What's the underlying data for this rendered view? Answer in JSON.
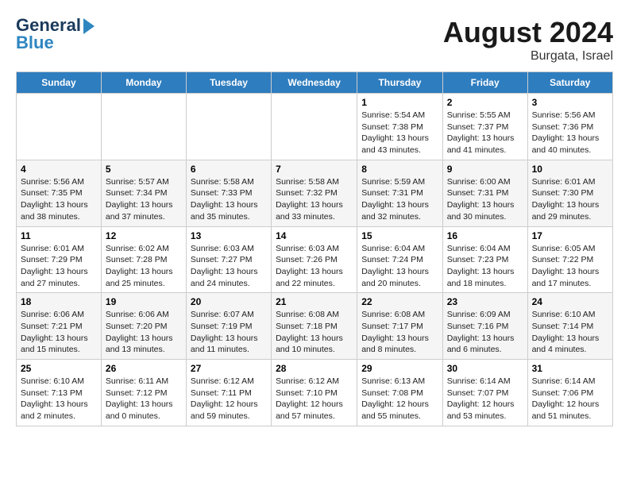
{
  "header": {
    "logo_line1": "General",
    "logo_line2": "Blue",
    "month_year": "August 2024",
    "location": "Burgata, Israel"
  },
  "weekdays": [
    "Sunday",
    "Monday",
    "Tuesday",
    "Wednesday",
    "Thursday",
    "Friday",
    "Saturday"
  ],
  "weeks": [
    [
      {
        "day": "",
        "info": ""
      },
      {
        "day": "",
        "info": ""
      },
      {
        "day": "",
        "info": ""
      },
      {
        "day": "",
        "info": ""
      },
      {
        "day": "1",
        "info": "Sunrise: 5:54 AM\nSunset: 7:38 PM\nDaylight: 13 hours\nand 43 minutes."
      },
      {
        "day": "2",
        "info": "Sunrise: 5:55 AM\nSunset: 7:37 PM\nDaylight: 13 hours\nand 41 minutes."
      },
      {
        "day": "3",
        "info": "Sunrise: 5:56 AM\nSunset: 7:36 PM\nDaylight: 13 hours\nand 40 minutes."
      }
    ],
    [
      {
        "day": "4",
        "info": "Sunrise: 5:56 AM\nSunset: 7:35 PM\nDaylight: 13 hours\nand 38 minutes."
      },
      {
        "day": "5",
        "info": "Sunrise: 5:57 AM\nSunset: 7:34 PM\nDaylight: 13 hours\nand 37 minutes."
      },
      {
        "day": "6",
        "info": "Sunrise: 5:58 AM\nSunset: 7:33 PM\nDaylight: 13 hours\nand 35 minutes."
      },
      {
        "day": "7",
        "info": "Sunrise: 5:58 AM\nSunset: 7:32 PM\nDaylight: 13 hours\nand 33 minutes."
      },
      {
        "day": "8",
        "info": "Sunrise: 5:59 AM\nSunset: 7:31 PM\nDaylight: 13 hours\nand 32 minutes."
      },
      {
        "day": "9",
        "info": "Sunrise: 6:00 AM\nSunset: 7:31 PM\nDaylight: 13 hours\nand 30 minutes."
      },
      {
        "day": "10",
        "info": "Sunrise: 6:01 AM\nSunset: 7:30 PM\nDaylight: 13 hours\nand 29 minutes."
      }
    ],
    [
      {
        "day": "11",
        "info": "Sunrise: 6:01 AM\nSunset: 7:29 PM\nDaylight: 13 hours\nand 27 minutes."
      },
      {
        "day": "12",
        "info": "Sunrise: 6:02 AM\nSunset: 7:28 PM\nDaylight: 13 hours\nand 25 minutes."
      },
      {
        "day": "13",
        "info": "Sunrise: 6:03 AM\nSunset: 7:27 PM\nDaylight: 13 hours\nand 24 minutes."
      },
      {
        "day": "14",
        "info": "Sunrise: 6:03 AM\nSunset: 7:26 PM\nDaylight: 13 hours\nand 22 minutes."
      },
      {
        "day": "15",
        "info": "Sunrise: 6:04 AM\nSunset: 7:24 PM\nDaylight: 13 hours\nand 20 minutes."
      },
      {
        "day": "16",
        "info": "Sunrise: 6:04 AM\nSunset: 7:23 PM\nDaylight: 13 hours\nand 18 minutes."
      },
      {
        "day": "17",
        "info": "Sunrise: 6:05 AM\nSunset: 7:22 PM\nDaylight: 13 hours\nand 17 minutes."
      }
    ],
    [
      {
        "day": "18",
        "info": "Sunrise: 6:06 AM\nSunset: 7:21 PM\nDaylight: 13 hours\nand 15 minutes."
      },
      {
        "day": "19",
        "info": "Sunrise: 6:06 AM\nSunset: 7:20 PM\nDaylight: 13 hours\nand 13 minutes."
      },
      {
        "day": "20",
        "info": "Sunrise: 6:07 AM\nSunset: 7:19 PM\nDaylight: 13 hours\nand 11 minutes."
      },
      {
        "day": "21",
        "info": "Sunrise: 6:08 AM\nSunset: 7:18 PM\nDaylight: 13 hours\nand 10 minutes."
      },
      {
        "day": "22",
        "info": "Sunrise: 6:08 AM\nSunset: 7:17 PM\nDaylight: 13 hours\nand 8 minutes."
      },
      {
        "day": "23",
        "info": "Sunrise: 6:09 AM\nSunset: 7:16 PM\nDaylight: 13 hours\nand 6 minutes."
      },
      {
        "day": "24",
        "info": "Sunrise: 6:10 AM\nSunset: 7:14 PM\nDaylight: 13 hours\nand 4 minutes."
      }
    ],
    [
      {
        "day": "25",
        "info": "Sunrise: 6:10 AM\nSunset: 7:13 PM\nDaylight: 13 hours\nand 2 minutes."
      },
      {
        "day": "26",
        "info": "Sunrise: 6:11 AM\nSunset: 7:12 PM\nDaylight: 13 hours\nand 0 minutes."
      },
      {
        "day": "27",
        "info": "Sunrise: 6:12 AM\nSunset: 7:11 PM\nDaylight: 12 hours\nand 59 minutes."
      },
      {
        "day": "28",
        "info": "Sunrise: 6:12 AM\nSunset: 7:10 PM\nDaylight: 12 hours\nand 57 minutes."
      },
      {
        "day": "29",
        "info": "Sunrise: 6:13 AM\nSunset: 7:08 PM\nDaylight: 12 hours\nand 55 minutes."
      },
      {
        "day": "30",
        "info": "Sunrise: 6:14 AM\nSunset: 7:07 PM\nDaylight: 12 hours\nand 53 minutes."
      },
      {
        "day": "31",
        "info": "Sunrise: 6:14 AM\nSunset: 7:06 PM\nDaylight: 12 hours\nand 51 minutes."
      }
    ]
  ]
}
